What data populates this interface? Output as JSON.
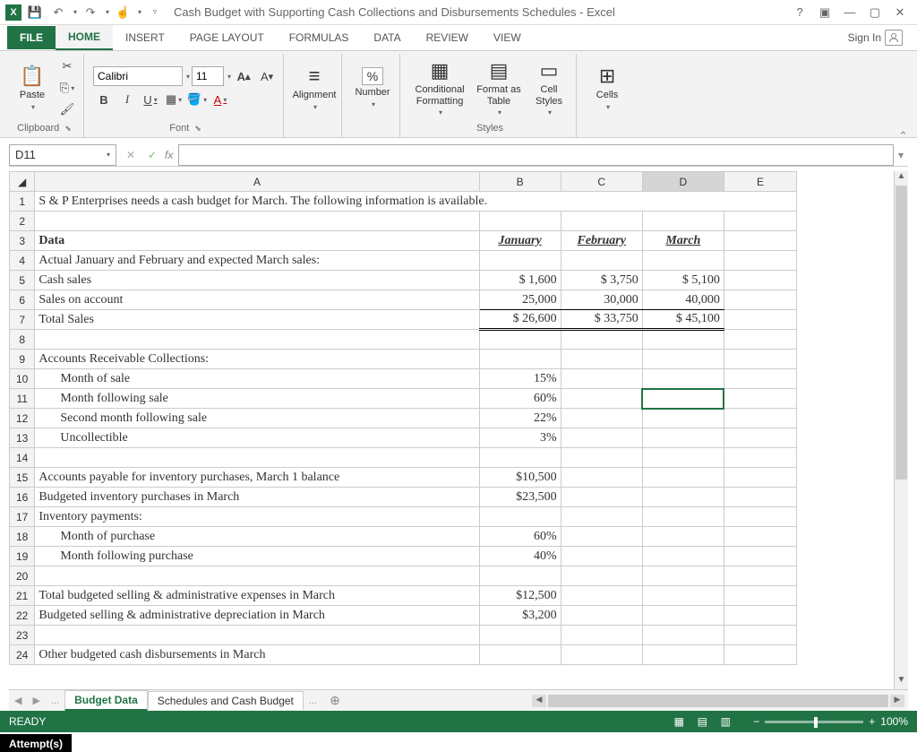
{
  "titlebar": {
    "app": "Excel",
    "doc_title": "Cash Budget with Supporting Cash Collections and Disbursements Schedules - Excel"
  },
  "tabs": {
    "file": "FILE",
    "home": "HOME",
    "insert": "INSERT",
    "page_layout": "PAGE LAYOUT",
    "formulas": "FORMULAS",
    "data": "DATA",
    "review": "REVIEW",
    "view": "VIEW",
    "signin": "Sign In"
  },
  "ribbon": {
    "paste": "Paste",
    "clipboard": "Clipboard",
    "font_name": "Calibri",
    "font_size": "11",
    "font": "Font",
    "alignment": "Alignment",
    "number": "Number",
    "percent": "%",
    "conditional_formatting": "Conditional Formatting",
    "format_as_table": "Format as Table",
    "cell_styles": "Cell Styles",
    "styles": "Styles",
    "cells": "Cells"
  },
  "formula_bar": {
    "name_box": "D11",
    "fx": "fx",
    "formula": ""
  },
  "columns": [
    "A",
    "B",
    "C",
    "D",
    "E"
  ],
  "rows": {
    "r1": {
      "a": "S & P Enterprises needs a cash budget for March. The following information is available."
    },
    "r3": {
      "a": "Data",
      "b": "January",
      "c": "February",
      "d": "March"
    },
    "r4": {
      "a": "Actual January and February and expected March sales:"
    },
    "r5": {
      "a": "Cash sales",
      "b": "$      1,600",
      "c": "$      3,750",
      "d": "$      5,100"
    },
    "r6": {
      "a": "Sales on account",
      "b": "25,000",
      "c": "30,000",
      "d": "40,000"
    },
    "r7": {
      "a": "Total Sales",
      "b": "$    26,600",
      "c": "$    33,750",
      "d": "$    45,100"
    },
    "r9": {
      "a": "Accounts Receivable Collections:"
    },
    "r10": {
      "a": "Month of sale",
      "b": "15%"
    },
    "r11": {
      "a": "Month following sale",
      "b": "60%"
    },
    "r12": {
      "a": "Second month following sale",
      "b": "22%"
    },
    "r13": {
      "a": "Uncollectible",
      "b": "3%"
    },
    "r15": {
      "a": "Accounts payable for inventory purchases, March 1 balance",
      "b": "$10,500"
    },
    "r16": {
      "a": "Budgeted inventory purchases in March",
      "b": "$23,500"
    },
    "r17": {
      "a": "Inventory payments:"
    },
    "r18": {
      "a": "Month of purchase",
      "b": "60%"
    },
    "r19": {
      "a": "Month following purchase",
      "b": "40%"
    },
    "r21": {
      "a": "Total budgeted selling & administrative expenses in March",
      "b": "$12,500"
    },
    "r22": {
      "a": "Budgeted selling & administrative depreciation in March",
      "b": "$3,200"
    },
    "r24": {
      "a": "Other budgeted cash disbursements in March"
    }
  },
  "sheet_tabs": {
    "budget_data": "Budget Data",
    "schedules": "Schedules and Cash Budget",
    "more": "..."
  },
  "status": {
    "ready": "READY",
    "zoom": "100%"
  },
  "attempts": "Attempt(s)"
}
